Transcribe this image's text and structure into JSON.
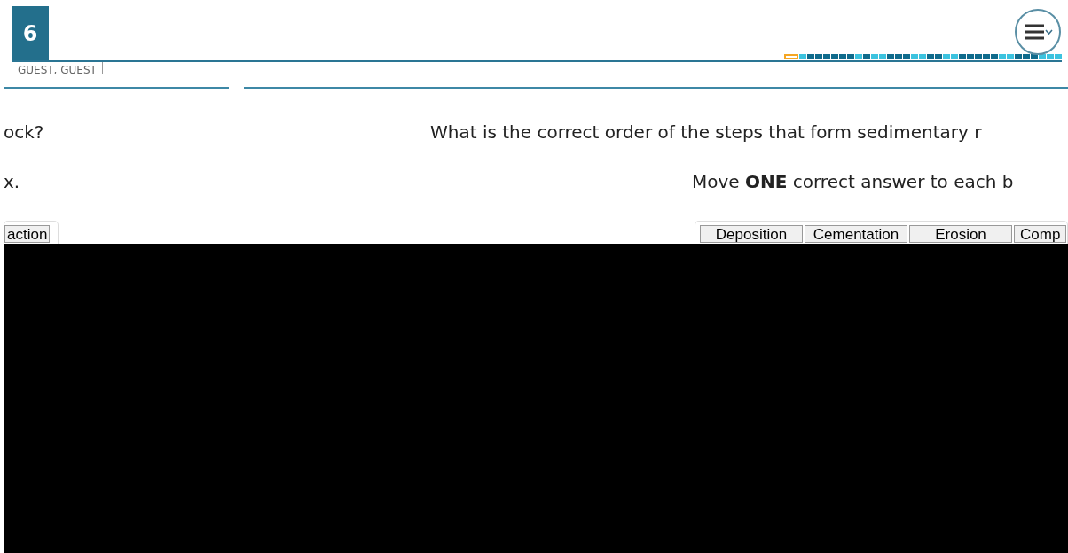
{
  "header": {
    "item_number": "6",
    "user": "GUEST, GUEST"
  },
  "progress": [
    {
      "selected": true,
      "color": "#f5a623"
    },
    {
      "selected": false,
      "color": "#3cc3df"
    },
    {
      "selected": false,
      "color": "#0f6b8c"
    },
    {
      "selected": false,
      "color": "#0f6b8c"
    },
    {
      "selected": false,
      "color": "#0f6b8c"
    },
    {
      "selected": false,
      "color": "#0f6b8c"
    },
    {
      "selected": false,
      "color": "#0f6b8c"
    },
    {
      "selected": false,
      "color": "#0f6b8c"
    },
    {
      "selected": false,
      "color": "#3cc3df"
    },
    {
      "selected": false,
      "color": "#0f6b8c"
    },
    {
      "selected": false,
      "color": "#3cc3df"
    },
    {
      "selected": false,
      "color": "#3cc3df"
    },
    {
      "selected": false,
      "color": "#0f6b8c"
    },
    {
      "selected": false,
      "color": "#0f6b8c"
    },
    {
      "selected": false,
      "color": "#0f6b8c"
    },
    {
      "selected": false,
      "color": "#3cc3df"
    },
    {
      "selected": false,
      "color": "#3cc3df"
    },
    {
      "selected": false,
      "color": "#0f6b8c"
    },
    {
      "selected": false,
      "color": "#0f6b8c"
    },
    {
      "selected": false,
      "color": "#3cc3df"
    },
    {
      "selected": false,
      "color": "#3cc3df"
    },
    {
      "selected": false,
      "color": "#0f6b8c"
    },
    {
      "selected": false,
      "color": "#0f6b8c"
    },
    {
      "selected": false,
      "color": "#0f6b8c"
    },
    {
      "selected": false,
      "color": "#0f6b8c"
    },
    {
      "selected": false,
      "color": "#0f6b8c"
    },
    {
      "selected": false,
      "color": "#3cc3df"
    },
    {
      "selected": false,
      "color": "#3cc3df"
    },
    {
      "selected": false,
      "color": "#0f6b8c"
    },
    {
      "selected": false,
      "color": "#0f6b8c"
    },
    {
      "selected": false,
      "color": "#0f6b8c"
    },
    {
      "selected": false,
      "color": "#3cc3df"
    },
    {
      "selected": false,
      "color": "#3cc3df"
    },
    {
      "selected": false,
      "color": "#3cc3df"
    }
  ],
  "left_panel": {
    "question": "ock?",
    "instruction": "x.",
    "options": [
      "action"
    ]
  },
  "right_panel": {
    "question": "What is the correct order of the steps that form sedimentary r",
    "instruction": "Move **ONE** correct answer to each b",
    "options": [
      "Deposition",
      "Cementation",
      "Erosion",
      "Comp"
    ]
  }
}
